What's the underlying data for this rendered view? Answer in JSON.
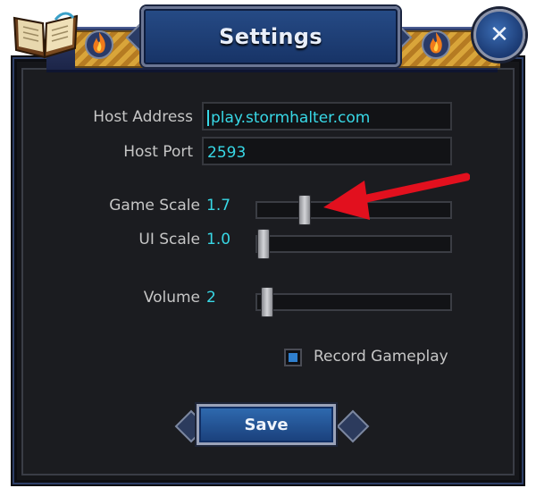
{
  "header": {
    "title": "Settings",
    "close_icon": "close-icon",
    "book_icon": "book-icon",
    "fire_icon": "fire-icon",
    "accent_color": "#264b86",
    "gold_color": "#d9a53a"
  },
  "form": {
    "host_address": {
      "label": "Host Address",
      "value": "play.stormhalter.com"
    },
    "host_port": {
      "label": "Host Port",
      "value": "2593"
    },
    "game_scale": {
      "label": "Game Scale",
      "value": "1.7",
      "level": 0.23
    },
    "ui_scale": {
      "label": "UI Scale",
      "value": "1.0",
      "level": 0.0
    },
    "volume": {
      "label": "Volume",
      "value": "2",
      "level": 0.02
    },
    "record_gameplay": {
      "label": "Record Gameplay",
      "checked": true
    },
    "value_color": "#38d8e6"
  },
  "footer": {
    "save_label": "Save"
  },
  "annotation": {
    "arrow_color": "#e2101e"
  }
}
